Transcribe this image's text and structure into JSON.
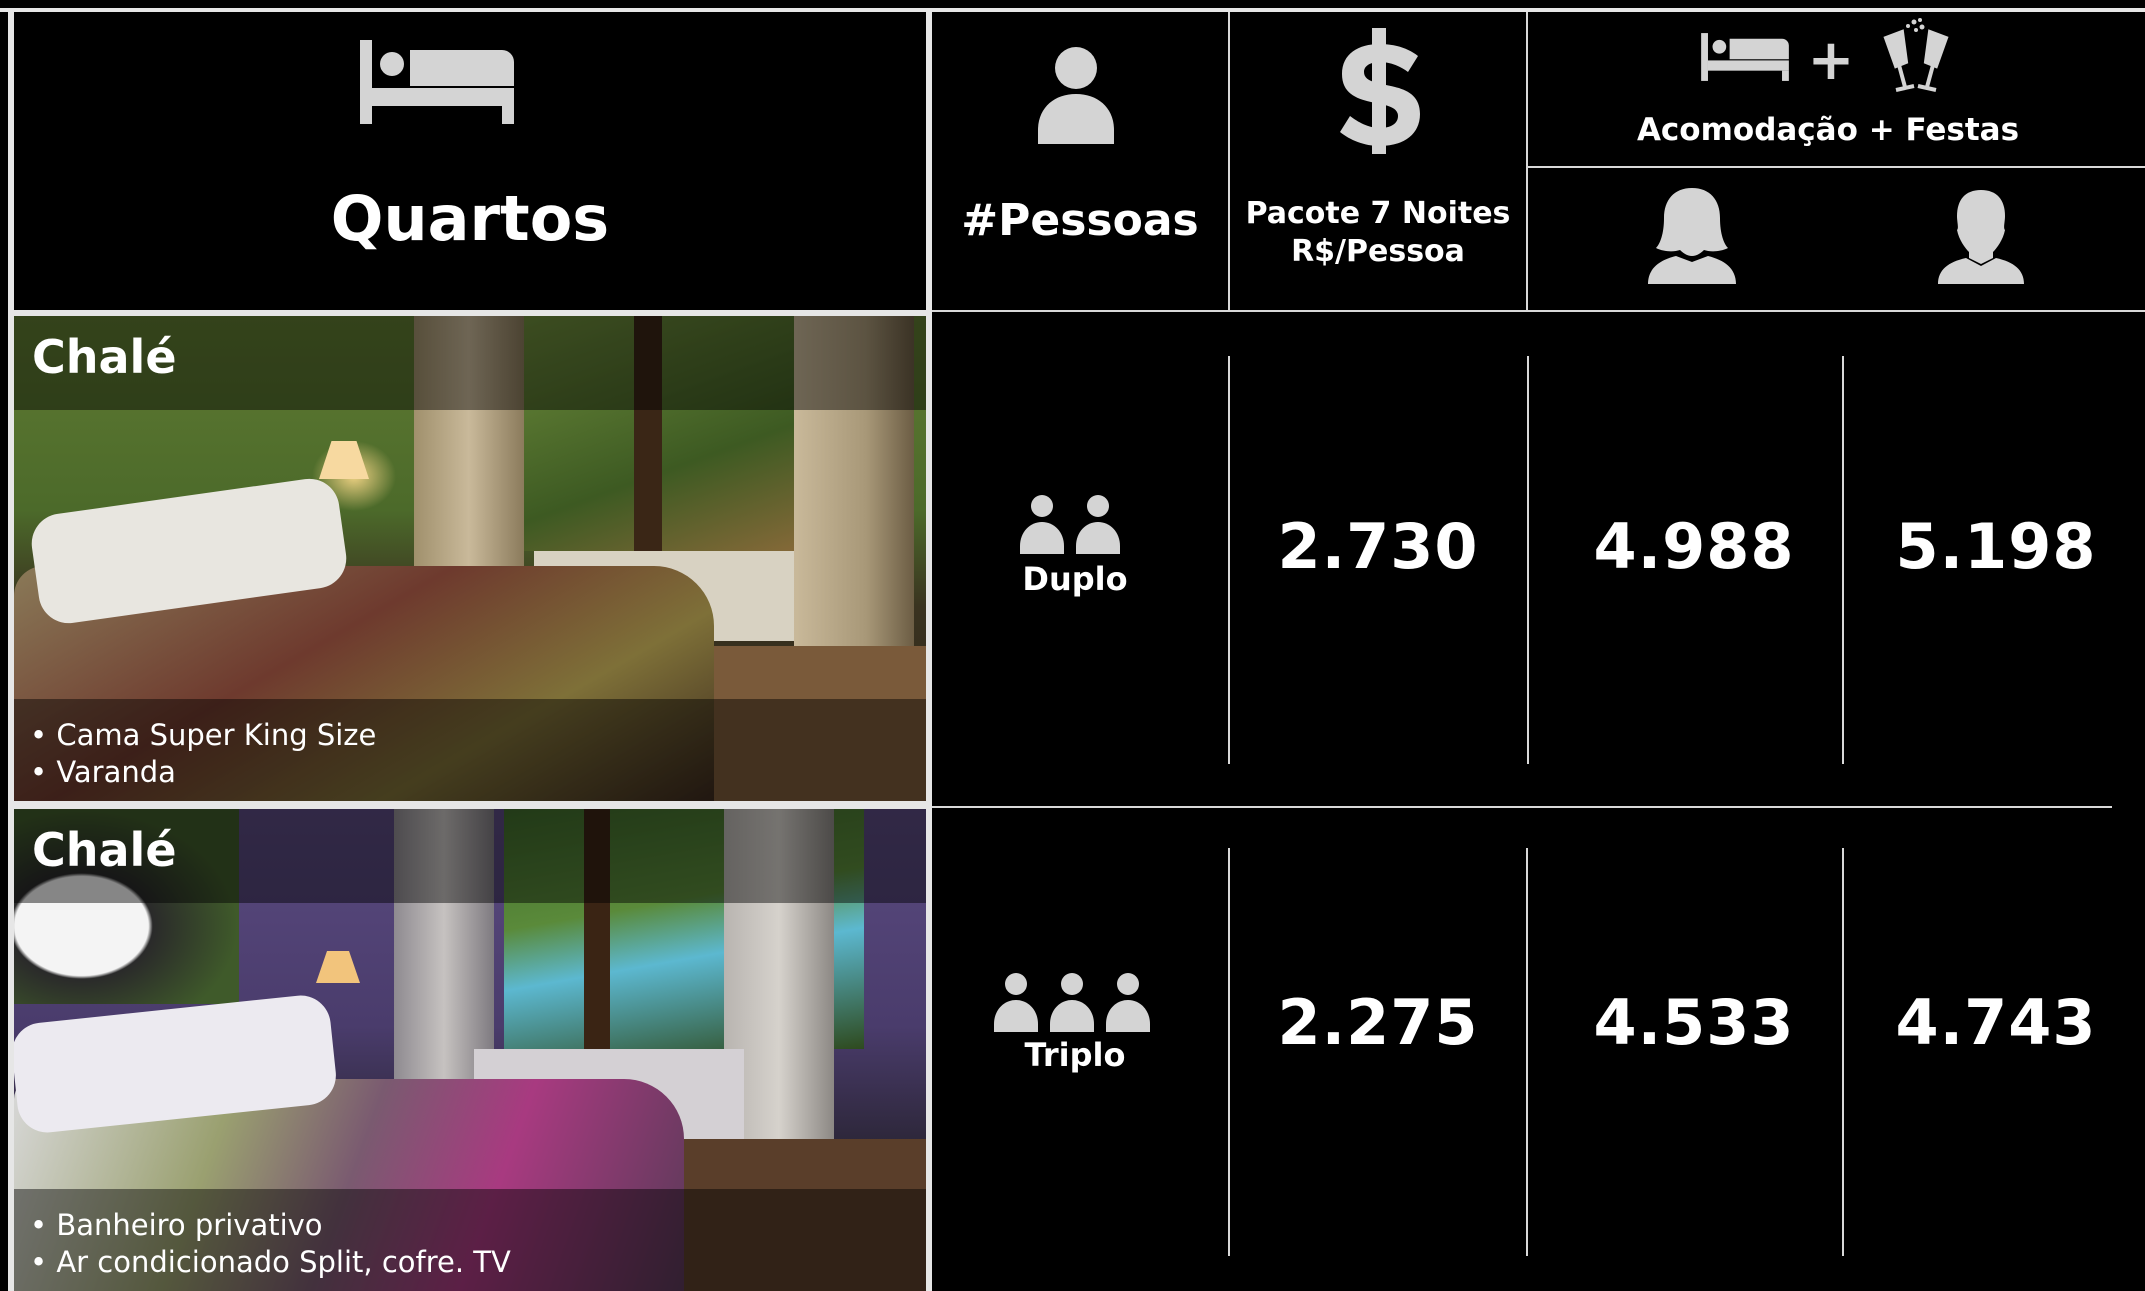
{
  "header": {
    "quartos_label": "Quartos",
    "pessoas_label": "#Pessoas",
    "pacote_line1": "Pacote 7 Noites",
    "pacote_line2": "R$/Pessoa",
    "acomodacao_label": "Acomodação + Festas",
    "plus_sign": "+"
  },
  "rooms": [
    {
      "title": "Chalé",
      "features": [
        "• Cama Super King Size",
        "• Varanda"
      ],
      "occupancy": "Duplo",
      "pacote": "2.730",
      "female": "4.988",
      "male": "5.198"
    },
    {
      "title": "Chalé",
      "features": [
        "• Banheiro privativo",
        "• Ar condicionado Split, cofre. TV"
      ],
      "occupancy": "Triplo",
      "pacote": "2.275",
      "female": "4.533",
      "male": "4.743"
    }
  ],
  "icons": [
    "bed-icon",
    "person-icon",
    "dollar-icon",
    "champagne-icon",
    "female-user-icon",
    "male-user-icon"
  ],
  "colors": {
    "background": "#000000",
    "lines": "#d9d9d9",
    "icons": "#d4d4d4",
    "text": "#ffffff"
  }
}
